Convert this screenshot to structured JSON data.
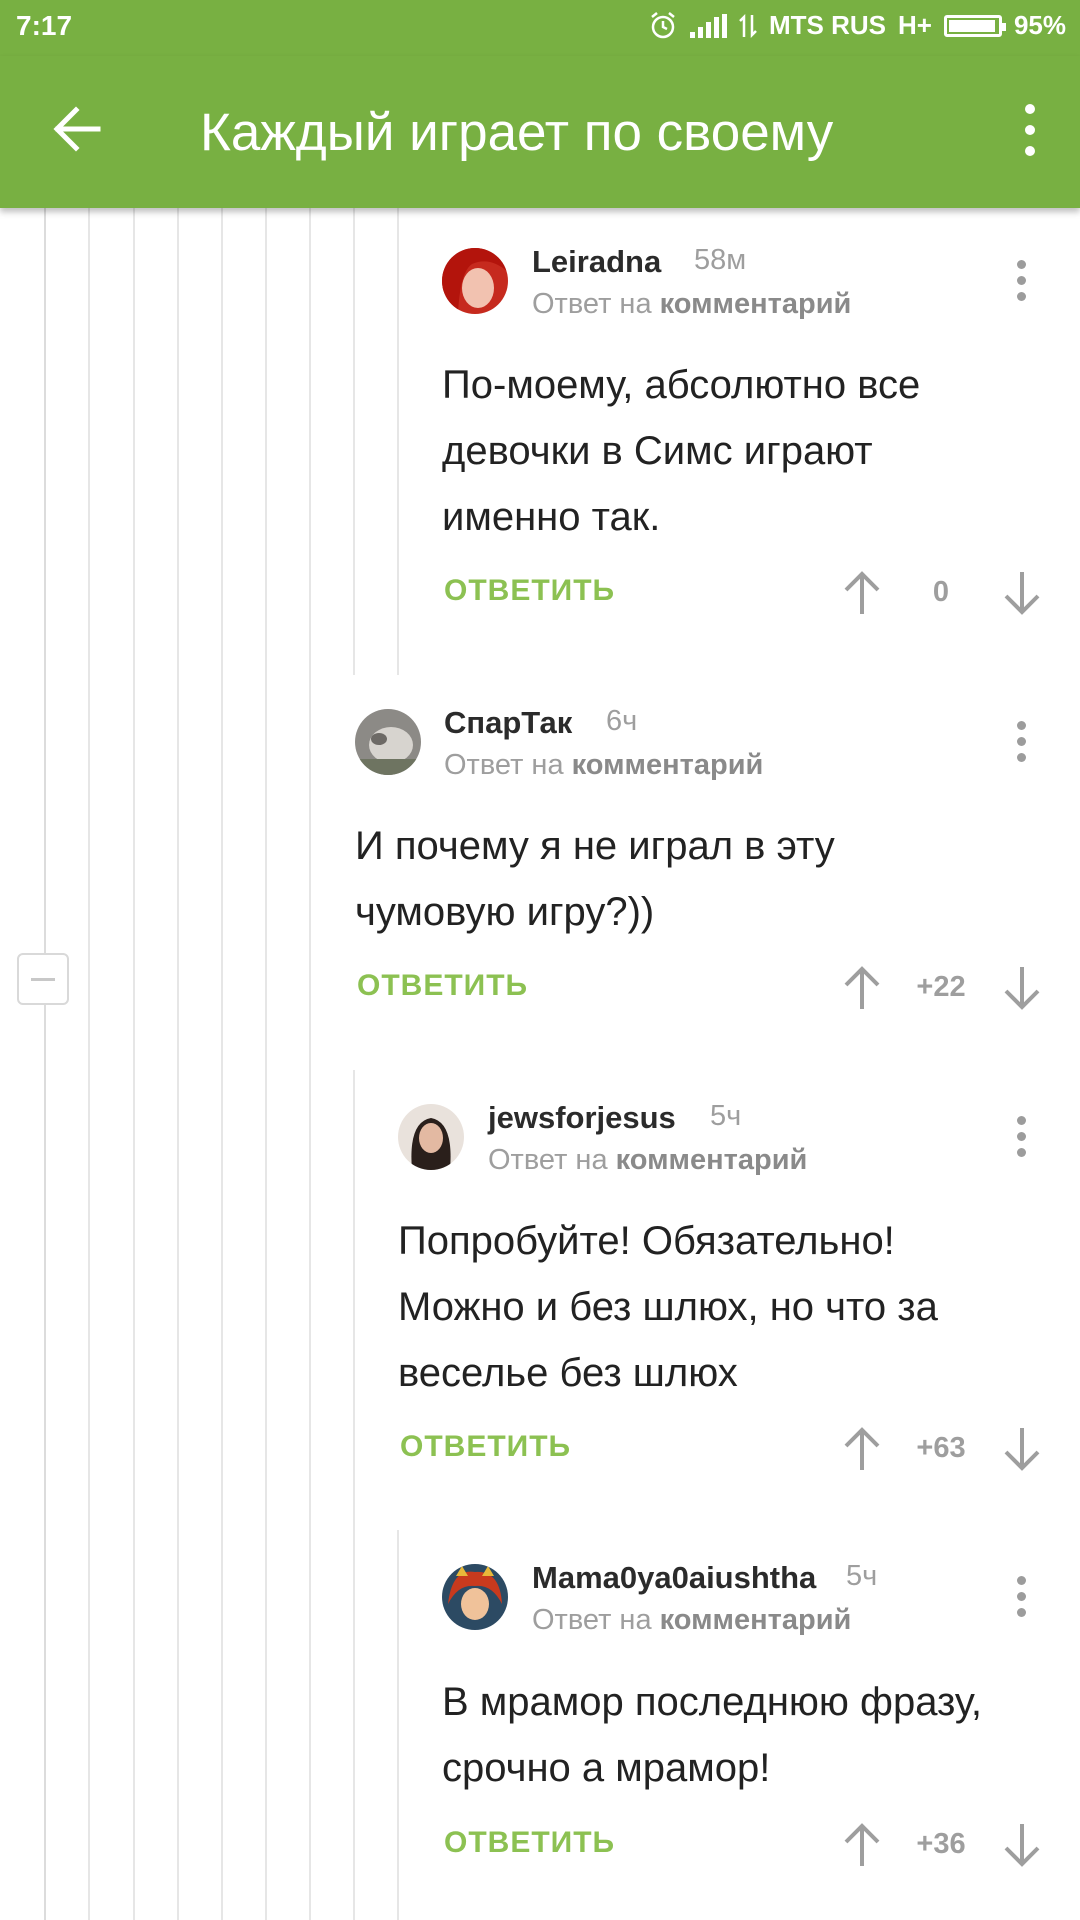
{
  "status_bar": {
    "time": "7:17",
    "carrier": "MTS RUS",
    "network": "H+",
    "battery": "95%",
    "battery_level": 0.95
  },
  "app_bar": {
    "title": "Каждый играет по своему",
    "back_icon": "arrow-left-icon",
    "menu_icon": "more-vertical-icon"
  },
  "colors": {
    "accent": "#78b042",
    "reply_action": "#8cc152",
    "muted_text": "#9e9e9e"
  },
  "comments": [
    {
      "author": "Leiradna",
      "time": "58м",
      "reply_prefix": "Ответ на",
      "reply_link": "комментарий",
      "text": "По-моему, абсолютно все девочки в Симс играют именно так.",
      "reply_label": "ОТВЕТИТЬ",
      "rating": "0"
    },
    {
      "author": "СпарТак",
      "time": "6ч",
      "reply_prefix": "Ответ на",
      "reply_link": "комментарий",
      "text": "И почему я не играл в эту чумовую игру?))",
      "reply_label": "ОТВЕТИТЬ",
      "rating": "+22"
    },
    {
      "author": "jewsforjesus",
      "time": "5ч",
      "reply_prefix": "Ответ на",
      "reply_link": "комментарий",
      "text": "Попробуйте! Обязательно! Можно и без шлюх, но что за веселье без шлюх",
      "reply_label": "ОТВЕТИТЬ",
      "rating": "+63"
    },
    {
      "author": "Mama0ya0aiushtha",
      "time": "5ч",
      "reply_prefix": "Ответ на",
      "reply_link": "комментарий",
      "text": "В мрамор последнюю фразу, срочно а мрамор!",
      "reply_label": "ОТВЕТИТЬ",
      "rating": "+36"
    }
  ]
}
